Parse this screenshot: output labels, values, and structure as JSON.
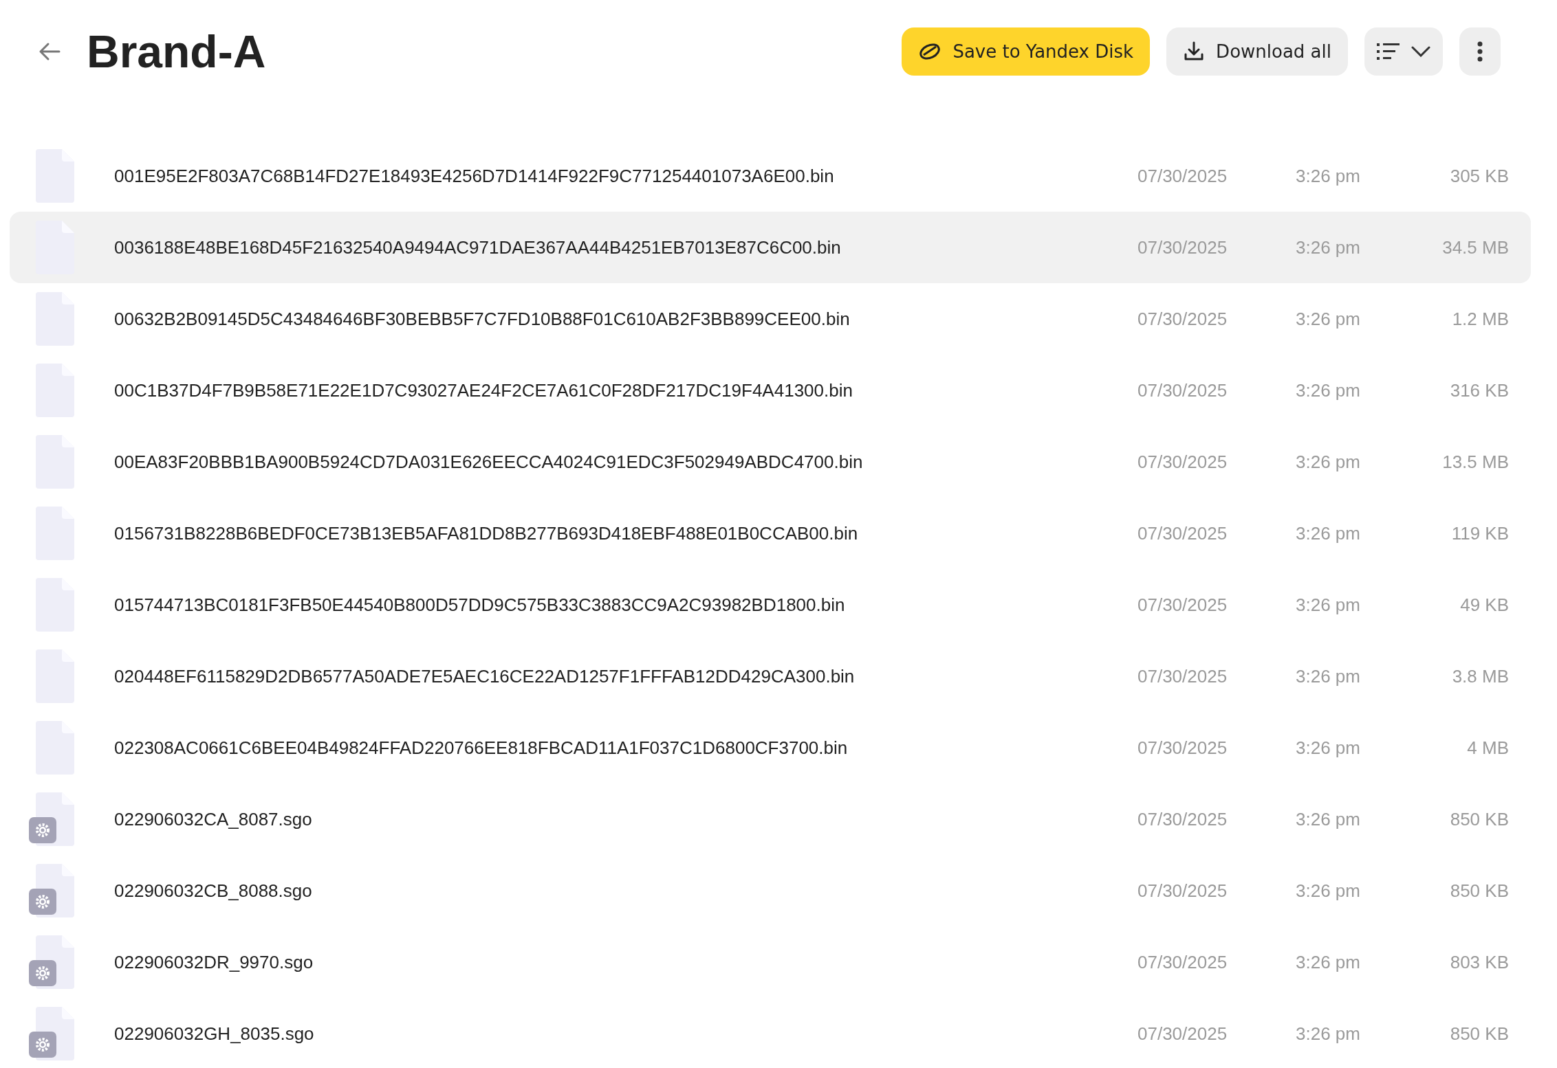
{
  "header": {
    "title": "Brand-A",
    "buttons": [
      {
        "kind": "save",
        "label": "Save to Yandex Disk"
      },
      {
        "kind": "download",
        "label": "Download all"
      }
    ]
  },
  "files": [
    {
      "kind": "file",
      "name": "001E95E2F803A7C68B14FD27E18493E4256D7D1414F922F9C771254401073A6E00.bin",
      "date": "07/30/2025",
      "time": "3:26 pm",
      "size": "305 KB",
      "selected": false
    },
    {
      "kind": "file",
      "name": "0036188E48BE168D45F21632540A9494AC971DAE367AA44B4251EB7013E87C6C00.bin",
      "date": "07/30/2025",
      "time": "3:26 pm",
      "size": "34.5 MB",
      "selected": true
    },
    {
      "kind": "file",
      "name": "00632B2B09145D5C43484646BF30BEBB5F7C7FD10B88F01C610AB2F3BB899CEE00.bin",
      "date": "07/30/2025",
      "time": "3:26 pm",
      "size": "1.2 MB",
      "selected": false
    },
    {
      "kind": "file",
      "name": "00C1B37D4F7B9B58E71E22E1D7C93027AE24F2CE7A61C0F28DF217DC19F4A41300.bin",
      "date": "07/30/2025",
      "time": "3:26 pm",
      "size": "316 KB",
      "selected": false
    },
    {
      "kind": "file",
      "name": "00EA83F20BBB1BA900B5924CD7DA031E626EECCA4024C91EDC3F502949ABDC4700.bin",
      "date": "07/30/2025",
      "time": "3:26 pm",
      "size": "13.5 MB",
      "selected": false
    },
    {
      "kind": "file",
      "name": "0156731B8228B6BEDF0CE73B13EB5AFA81DD8B277B693D418EBF488E01B0CCAB00.bin",
      "date": "07/30/2025",
      "time": "3:26 pm",
      "size": "119 KB",
      "selected": false
    },
    {
      "kind": "file",
      "name": "015744713BC0181F3FB50E44540B800D57DD9C575B33C3883CC9A2C93982BD1800.bin",
      "date": "07/30/2025",
      "time": "3:26 pm",
      "size": "49 KB",
      "selected": false
    },
    {
      "kind": "file",
      "name": "020448EF6115829D2DB6577A50ADE7E5AEC16CE22AD1257F1FFFAB12DD429CA300.bin",
      "date": "07/30/2025",
      "time": "3:26 pm",
      "size": "3.8 MB",
      "selected": false
    },
    {
      "kind": "file",
      "name": "022308AC0661C6BEE04B49824FFAD220766EE818FBCAD11A1F037C1D6800CF3700.bin",
      "date": "07/30/2025",
      "time": "3:26 pm",
      "size": "4 MB",
      "selected": false
    },
    {
      "kind": "settings",
      "name": "022906032CA_8087.sgo",
      "date": "07/30/2025",
      "time": "3:26 pm",
      "size": "850 KB",
      "selected": false
    },
    {
      "kind": "settings",
      "name": "022906032CB_8088.sgo",
      "date": "07/30/2025",
      "time": "3:26 pm",
      "size": "850 KB",
      "selected": false
    },
    {
      "kind": "settings",
      "name": "022906032DR_9970.sgo",
      "date": "07/30/2025",
      "time": "3:26 pm",
      "size": "803 KB",
      "selected": false
    },
    {
      "kind": "settings",
      "name": "022906032GH_8035.sgo",
      "date": "07/30/2025",
      "time": "3:26 pm",
      "size": "850 KB",
      "selected": false
    }
  ]
}
